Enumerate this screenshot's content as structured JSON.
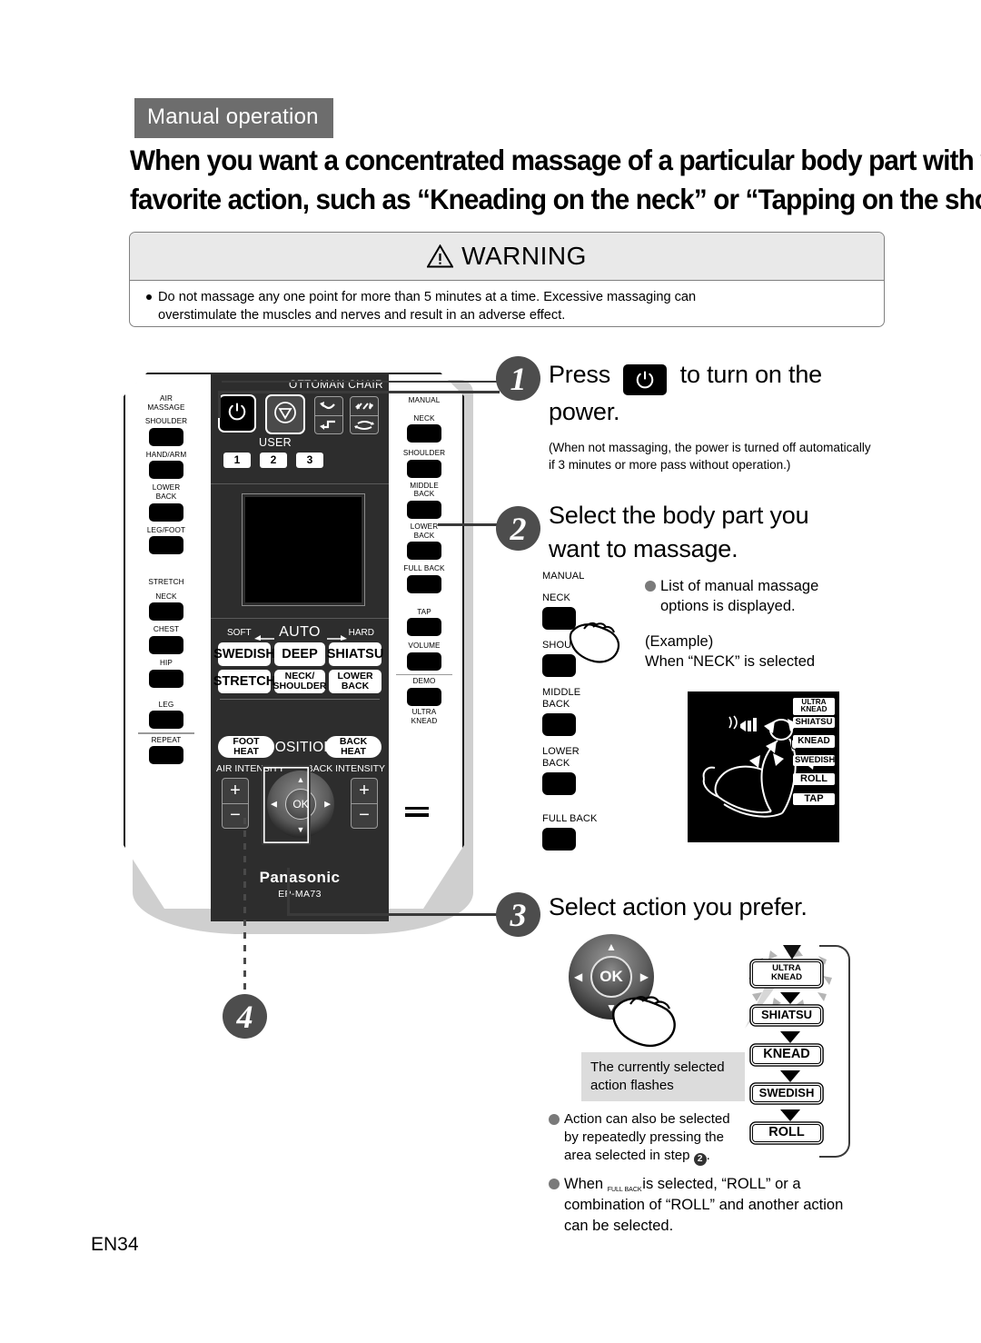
{
  "header": {
    "section_label": "Manual operation",
    "headline_line1": "When you want a concentrated massage of a particular body part with your",
    "headline_line2": "favorite action, such as “Kneading on the neck” or “Tapping on the shoulder”"
  },
  "warning": {
    "title": "WARNING",
    "icon": "warning-triangle-icon",
    "body_line1": "Do not massage any one point for more than 5 minutes at a time. Excessive massaging can",
    "body_line2": "overstimulate the muscles and nerves and result in an adverse effect."
  },
  "remote": {
    "brand": "Panasonic",
    "model": "EP-MA73",
    "ottoman_chair_label": "OTTOMAN  CHAIR",
    "user_label": "USER",
    "user_keys": [
      "1",
      "2",
      "3"
    ],
    "power_icon": "power-icon",
    "stop_icon": "stop-icon",
    "left_column": [
      {
        "label": "AIR\nMASSAGE",
        "has_key": false
      },
      {
        "label": "SHOULDER",
        "has_key": true
      },
      {
        "label": "HAND/ARM",
        "has_key": true
      },
      {
        "label": "LOWER\nBACK",
        "has_key": true
      },
      {
        "label": "LEG/FOOT",
        "has_key": true
      },
      {
        "label": "STRETCH",
        "has_key": false
      },
      {
        "label": "NECK",
        "has_key": true
      },
      {
        "label": "CHEST",
        "has_key": true
      },
      {
        "label": "HIP",
        "has_key": true
      },
      {
        "label": "LEG",
        "has_key": true
      },
      {
        "label": "REPEAT",
        "has_key": true
      }
    ],
    "right_column": [
      {
        "label": "MANUAL",
        "has_key": false
      },
      {
        "label": "NECK",
        "has_key": true
      },
      {
        "label": "SHOULDER",
        "has_key": true
      },
      {
        "label": "MIDDLE\nBACK",
        "has_key": true
      },
      {
        "label": "LOWER\nBACK",
        "has_key": true
      },
      {
        "label": "FULL BACK",
        "has_key": true
      },
      {
        "label": "TAP",
        "has_key": true
      },
      {
        "label": "VOLUME",
        "has_key": true
      },
      {
        "label": "DEMO",
        "has_key": true
      },
      {
        "label": "ULTRA\nKNEAD",
        "has_key": false
      }
    ],
    "auto_row": {
      "soft": "SOFT",
      "auto": "AUTO",
      "hard": "HARD"
    },
    "program_buttons": [
      "SWEDISH",
      "DEEP",
      "SHIATSU",
      "STRETCH",
      "NECK/\nSHOULDER",
      "LOWER BACK"
    ],
    "foot_heat": "FOOT\nHEAT",
    "position": "POSITION",
    "back_heat": "BACK\nHEAT",
    "air_intensity": "AIR INTENSITY",
    "back_intensity": "BACK INTENSITY",
    "plus": "+",
    "minus": "−",
    "ok": "OK"
  },
  "step1": {
    "number": "1",
    "title_before": "Press",
    "title_after": "to turn on the",
    "title_line2": "power.",
    "button_icon": "power-icon",
    "note_line1": "(When not massaging, the power is turned off automatically",
    "note_line2": " if 3 minutes or more pass without operation.)"
  },
  "step2": {
    "number": "2",
    "title_line1": "Select the body part you",
    "title_line2": "want to massage.",
    "buttons": [
      {
        "label": "MANUAL",
        "has_key": false
      },
      {
        "label": "NECK",
        "has_key": true
      },
      {
        "label": "SHOULDER",
        "has_key": true
      },
      {
        "label": "MIDDLE\nBACK",
        "has_key": true
      },
      {
        "label": "LOWER\nBACK",
        "has_key": true
      },
      {
        "label": "FULL BACK",
        "has_key": true
      }
    ],
    "bullet_line1": "List of manual massage",
    "bullet_line2": "options is displayed.",
    "example_line1": "(Example)",
    "example_line2": "When “NECK” is selected",
    "lcd_options": [
      "ULTRA\nKNEAD",
      "SHIATSU",
      "KNEAD",
      "SWEDISH",
      "ROLL",
      "TAP"
    ],
    "lcd_selected": "KNEAD"
  },
  "step3": {
    "number": "3",
    "title": "Select action you prefer.",
    "ok": "OK",
    "flash_note_line1": "The currently selected",
    "flash_note_line2": "action flashes",
    "bullet_line1": "Action can also be selected",
    "bullet_line2": "by repeatedly pressing the",
    "bullet_line3_pre": "area selected in step ",
    "bullet_line3_num": "2",
    "bullet_line3_post": ".",
    "cycle": [
      "ULTRA\nKNEAD",
      "SHIATSU",
      "KNEAD",
      "SWEDISH",
      "ROLL"
    ],
    "cycle_flashing": "ULTRA KNEAD"
  },
  "step4": {
    "number": "4"
  },
  "bottom_note": {
    "line1_pre": "When",
    "fullback_label": "FULL BACK",
    "line1_post": "is selected, “ROLL” or a",
    "line2": "combination of “ROLL” and another action",
    "line3": "can be selected."
  },
  "page_number": "EN34",
  "colors": {
    "section_bg": "#6d6d6d",
    "badge": "#4d4d4d",
    "warning_head": "#e9e9e9",
    "remote_panel": "#2d2d2d",
    "bullet": "#7a7a7a"
  }
}
